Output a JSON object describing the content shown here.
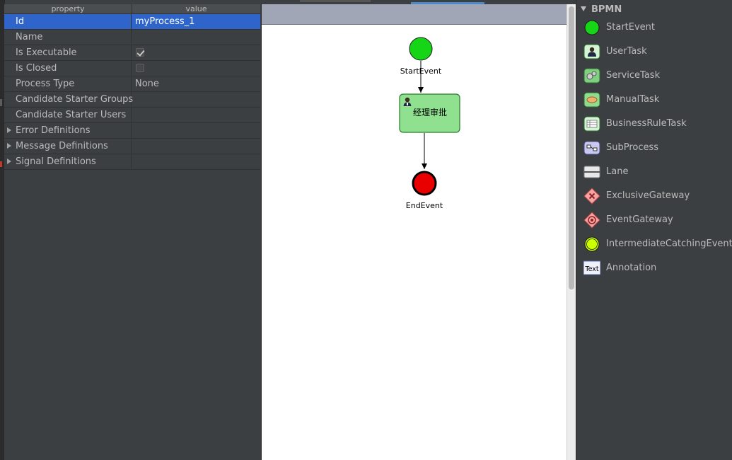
{
  "properties": {
    "header": {
      "property": "property",
      "value": "value"
    },
    "rows": [
      {
        "name": "Id",
        "value": "myProcess_1",
        "selected": true
      },
      {
        "name": "Name",
        "value": ""
      },
      {
        "name": "Is Executable",
        "checkbox": true,
        "checked": true
      },
      {
        "name": "Is Closed",
        "checkbox": true,
        "checked": false
      },
      {
        "name": "Process Type",
        "value": "None"
      },
      {
        "name": "Candidate Starter Groups",
        "value": ""
      },
      {
        "name": "Candidate Starter Users",
        "value": ""
      },
      {
        "name": "Error Definitions",
        "expandable": true
      },
      {
        "name": "Message Definitions",
        "expandable": true
      },
      {
        "name": "Signal Definitions",
        "expandable": true
      }
    ]
  },
  "diagram": {
    "start_event": {
      "label": "StartEvent",
      "color": "#16d416"
    },
    "user_task": {
      "label": "经理审批",
      "fill": "#8fe08f",
      "stroke": "#2a7a2a"
    },
    "end_event": {
      "label": "EndEvent",
      "color": "#e80000"
    }
  },
  "palette": {
    "title": "BPMN",
    "items": [
      {
        "label": "StartEvent",
        "icon": "start-event-icon"
      },
      {
        "label": "UserTask",
        "icon": "user-task-icon"
      },
      {
        "label": "ServiceTask",
        "icon": "service-task-icon"
      },
      {
        "label": "ManualTask",
        "icon": "manual-task-icon"
      },
      {
        "label": "BusinessRuleTask",
        "icon": "business-rule-task-icon"
      },
      {
        "label": "SubProcess",
        "icon": "subprocess-icon"
      },
      {
        "label": "Lane",
        "icon": "lane-icon"
      },
      {
        "label": "ExclusiveGateway",
        "icon": "exclusive-gateway-icon"
      },
      {
        "label": "EventGateway",
        "icon": "event-gateway-icon"
      },
      {
        "label": "IntermediateCatchingEvent",
        "icon": "intermediate-catching-event-icon"
      },
      {
        "label": "Annotation",
        "icon": "annotation-icon",
        "icon_text": "Text"
      }
    ]
  }
}
